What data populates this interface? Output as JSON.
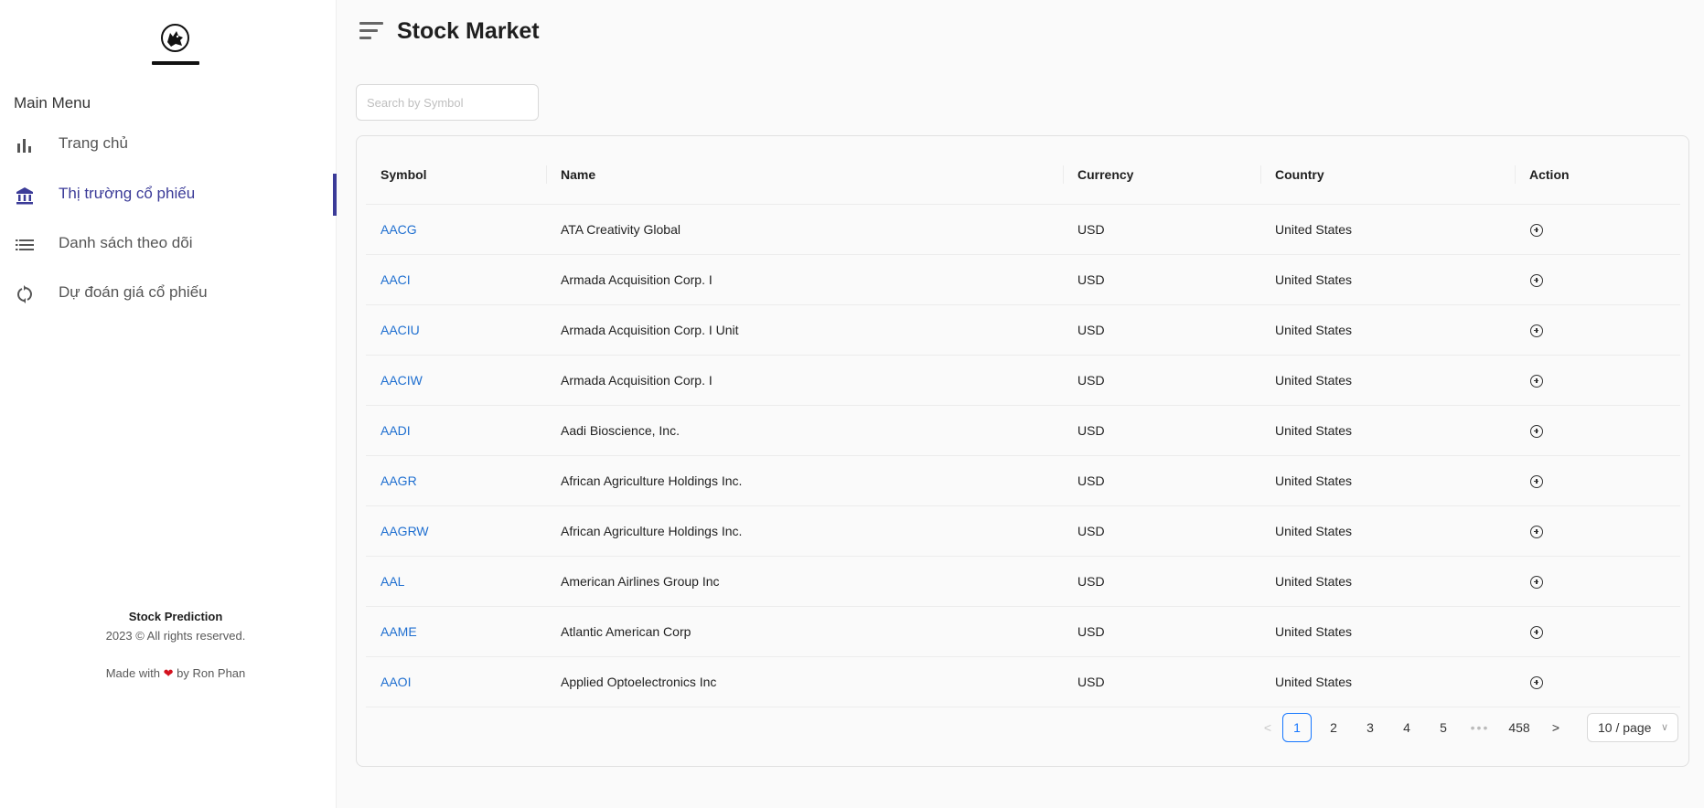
{
  "sidebar": {
    "menu_title": "Main Menu",
    "items": [
      {
        "label": "Trang chủ",
        "icon": "bar-chart-icon"
      },
      {
        "label": "Thị trường cổ phiếu",
        "icon": "bank-icon",
        "active": true
      },
      {
        "label": "Danh sách theo dõi",
        "icon": "list-icon"
      },
      {
        "label": "Dự đoán giá cổ phiếu",
        "icon": "sync-icon"
      }
    ],
    "footer": {
      "title": "Stock Prediction",
      "copyright": "2023 © All rights reserved.",
      "made_prefix": "Made with",
      "heart": "❤",
      "made_suffix": "by Ron Phan"
    }
  },
  "header": {
    "title": "Stock Market"
  },
  "search": {
    "placeholder": "Search by Symbol",
    "value": ""
  },
  "table": {
    "columns": [
      "Symbol",
      "Name",
      "Currency",
      "Country",
      "Action"
    ],
    "rows": [
      {
        "symbol": "AACG",
        "name": "ATA Creativity Global",
        "currency": "USD",
        "country": "United States"
      },
      {
        "symbol": "AACI",
        "name": "Armada Acquisition Corp. I",
        "currency": "USD",
        "country": "United States"
      },
      {
        "symbol": "AACIU",
        "name": "Armada Acquisition Corp. I Unit",
        "currency": "USD",
        "country": "United States"
      },
      {
        "symbol": "AACIW",
        "name": "Armada Acquisition Corp. I",
        "currency": "USD",
        "country": "United States"
      },
      {
        "symbol": "AADI",
        "name": "Aadi Bioscience, Inc.",
        "currency": "USD",
        "country": "United States"
      },
      {
        "symbol": "AAGR",
        "name": "African Agriculture Holdings Inc.",
        "currency": "USD",
        "country": "United States"
      },
      {
        "symbol": "AAGRW",
        "name": "African Agriculture Holdings Inc.",
        "currency": "USD",
        "country": "United States"
      },
      {
        "symbol": "AAL",
        "name": "American Airlines Group Inc",
        "currency": "USD",
        "country": "United States"
      },
      {
        "symbol": "AAME",
        "name": "Atlantic American Corp",
        "currency": "USD",
        "country": "United States"
      },
      {
        "symbol": "AAOI",
        "name": "Applied Optoelectronics Inc",
        "currency": "USD",
        "country": "United States"
      }
    ]
  },
  "pagination": {
    "prev": "<",
    "pages": [
      "1",
      "2",
      "3",
      "4",
      "5"
    ],
    "ellipsis": "•••",
    "last": "458",
    "next": ">",
    "current": "1",
    "page_size": "10 / page"
  },
  "colors": {
    "accent": "#3b3b98",
    "link": "#1f6fd0",
    "pagination_active": "#1677ff"
  }
}
